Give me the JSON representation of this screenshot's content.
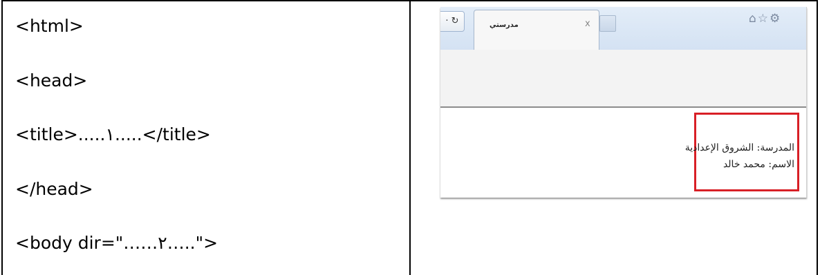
{
  "code_lines": [
    "<html>",
    "<head>",
    "<title>.....١.....</title>",
    "</head>",
    "<body dir=\"……٢…..\">"
  ],
  "browser": {
    "refresh_icon": "refresh-icon",
    "tab_title": "مدرستي",
    "tab_close": "x",
    "toolbar_icons": "⌂☆⚙"
  },
  "page_content": {
    "line1": "المدرسة: الشروق الإعدادية",
    "line2": "الاسم: محمد خالد"
  }
}
